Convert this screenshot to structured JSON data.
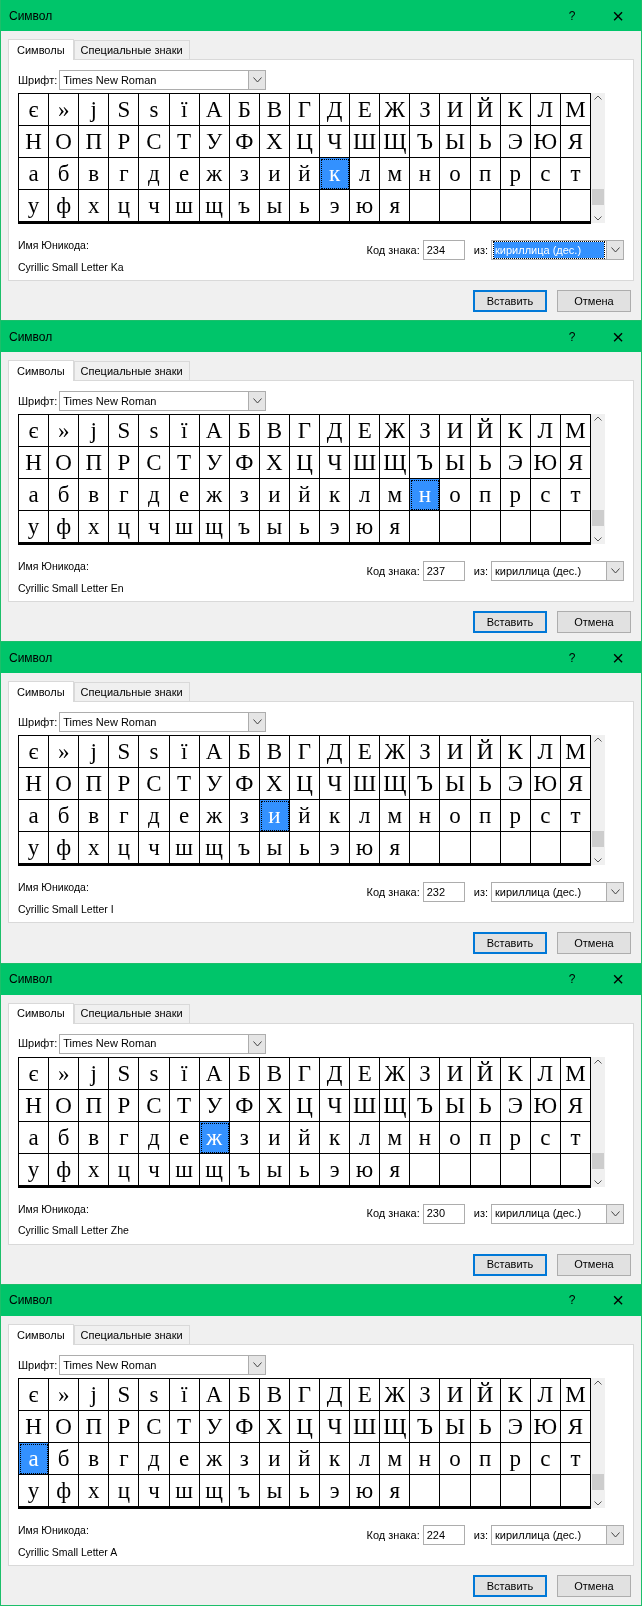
{
  "dialogs": [
    {
      "title": "Символ",
      "help": "?",
      "close": "×",
      "tabs": [
        {
          "label": "Символы",
          "selected": true
        },
        {
          "label": "Специальные знаки",
          "selected": false
        }
      ],
      "font_label": "Шрифт:",
      "font": "Times New Roman",
      "grid": [
        [
          {
            "char": "є",
            "selected": false
          },
          {
            "char": "»",
            "selected": false
          },
          {
            "char": "ј",
            "selected": false
          },
          {
            "char": "Ѕ",
            "selected": false
          },
          {
            "char": "ѕ",
            "selected": false
          },
          {
            "char": "ї",
            "selected": false
          },
          {
            "char": "А",
            "selected": false
          },
          {
            "char": "Б",
            "selected": false
          },
          {
            "char": "В",
            "selected": false
          },
          {
            "char": "Г",
            "selected": false
          },
          {
            "char": "Д",
            "selected": false
          },
          {
            "char": "Е",
            "selected": false
          },
          {
            "char": "Ж",
            "selected": false
          },
          {
            "char": "З",
            "selected": false
          },
          {
            "char": "И",
            "selected": false
          },
          {
            "char": "Й",
            "selected": false
          },
          {
            "char": "К",
            "selected": false
          },
          {
            "char": "Л",
            "selected": false
          },
          {
            "char": "М",
            "selected": false
          }
        ],
        [
          {
            "char": "Н",
            "selected": false
          },
          {
            "char": "О",
            "selected": false
          },
          {
            "char": "П",
            "selected": false
          },
          {
            "char": "Р",
            "selected": false
          },
          {
            "char": "С",
            "selected": false
          },
          {
            "char": "Т",
            "selected": false
          },
          {
            "char": "У",
            "selected": false
          },
          {
            "char": "Ф",
            "selected": false
          },
          {
            "char": "Х",
            "selected": false
          },
          {
            "char": "Ц",
            "selected": false
          },
          {
            "char": "Ч",
            "selected": false
          },
          {
            "char": "Ш",
            "selected": false
          },
          {
            "char": "Щ",
            "selected": false
          },
          {
            "char": "Ъ",
            "selected": false
          },
          {
            "char": "Ы",
            "selected": false
          },
          {
            "char": "Ь",
            "selected": false
          },
          {
            "char": "Э",
            "selected": false
          },
          {
            "char": "Ю",
            "selected": false
          },
          {
            "char": "Я",
            "selected": false
          }
        ],
        [
          {
            "char": "а",
            "selected": false
          },
          {
            "char": "б",
            "selected": false
          },
          {
            "char": "в",
            "selected": false
          },
          {
            "char": "г",
            "selected": false
          },
          {
            "char": "д",
            "selected": false
          },
          {
            "char": "е",
            "selected": false
          },
          {
            "char": "ж",
            "selected": false
          },
          {
            "char": "з",
            "selected": false
          },
          {
            "char": "и",
            "selected": false
          },
          {
            "char": "й",
            "selected": false
          },
          {
            "char": "к",
            "selected": true
          },
          {
            "char": "л",
            "selected": false
          },
          {
            "char": "м",
            "selected": false
          },
          {
            "char": "н",
            "selected": false
          },
          {
            "char": "о",
            "selected": false
          },
          {
            "char": "п",
            "selected": false
          },
          {
            "char": "р",
            "selected": false
          },
          {
            "char": "с",
            "selected": false
          },
          {
            "char": "т",
            "selected": false
          }
        ],
        [
          {
            "char": "у",
            "selected": false
          },
          {
            "char": "ф",
            "selected": false
          },
          {
            "char": "х",
            "selected": false
          },
          {
            "char": "ц",
            "selected": false
          },
          {
            "char": "ч",
            "selected": false
          },
          {
            "char": "ш",
            "selected": false
          },
          {
            "char": "щ",
            "selected": false
          },
          {
            "char": "ъ",
            "selected": false
          },
          {
            "char": "ы",
            "selected": false
          },
          {
            "char": "ь",
            "selected": false
          },
          {
            "char": "э",
            "selected": false
          },
          {
            "char": "ю",
            "selected": false
          },
          {
            "char": "я",
            "selected": false
          }
        ]
      ],
      "unicode_label": "Имя Юникода:",
      "unicode_name": "Cyrillic Small Letter Ka",
      "code_label": "Код знака:",
      "code": "234",
      "from_label": "из:",
      "from": "кириллица (дес.)",
      "from_focused": true,
      "insert": "Вставить",
      "cancel": "Отмена"
    },
    {
      "title": "Символ",
      "help": "?",
      "close": "×",
      "tabs": [
        {
          "label": "Символы",
          "selected": true
        },
        {
          "label": "Специальные знаки",
          "selected": false
        }
      ],
      "font_label": "Шрифт:",
      "font": "Times New Roman",
      "grid": [
        [
          {
            "char": "є",
            "selected": false
          },
          {
            "char": "»",
            "selected": false
          },
          {
            "char": "ј",
            "selected": false
          },
          {
            "char": "Ѕ",
            "selected": false
          },
          {
            "char": "ѕ",
            "selected": false
          },
          {
            "char": "ї",
            "selected": false
          },
          {
            "char": "А",
            "selected": false
          },
          {
            "char": "Б",
            "selected": false
          },
          {
            "char": "В",
            "selected": false
          },
          {
            "char": "Г",
            "selected": false
          },
          {
            "char": "Д",
            "selected": false
          },
          {
            "char": "Е",
            "selected": false
          },
          {
            "char": "Ж",
            "selected": false
          },
          {
            "char": "З",
            "selected": false
          },
          {
            "char": "И",
            "selected": false
          },
          {
            "char": "Й",
            "selected": false
          },
          {
            "char": "К",
            "selected": false
          },
          {
            "char": "Л",
            "selected": false
          },
          {
            "char": "М",
            "selected": false
          }
        ],
        [
          {
            "char": "Н",
            "selected": false
          },
          {
            "char": "О",
            "selected": false
          },
          {
            "char": "П",
            "selected": false
          },
          {
            "char": "Р",
            "selected": false
          },
          {
            "char": "С",
            "selected": false
          },
          {
            "char": "Т",
            "selected": false
          },
          {
            "char": "У",
            "selected": false
          },
          {
            "char": "Ф",
            "selected": false
          },
          {
            "char": "Х",
            "selected": false
          },
          {
            "char": "Ц",
            "selected": false
          },
          {
            "char": "Ч",
            "selected": false
          },
          {
            "char": "Ш",
            "selected": false
          },
          {
            "char": "Щ",
            "selected": false
          },
          {
            "char": "Ъ",
            "selected": false
          },
          {
            "char": "Ы",
            "selected": false
          },
          {
            "char": "Ь",
            "selected": false
          },
          {
            "char": "Э",
            "selected": false
          },
          {
            "char": "Ю",
            "selected": false
          },
          {
            "char": "Я",
            "selected": false
          }
        ],
        [
          {
            "char": "а",
            "selected": false
          },
          {
            "char": "б",
            "selected": false
          },
          {
            "char": "в",
            "selected": false
          },
          {
            "char": "г",
            "selected": false
          },
          {
            "char": "д",
            "selected": false
          },
          {
            "char": "е",
            "selected": false
          },
          {
            "char": "ж",
            "selected": false
          },
          {
            "char": "з",
            "selected": false
          },
          {
            "char": "и",
            "selected": false
          },
          {
            "char": "й",
            "selected": false
          },
          {
            "char": "к",
            "selected": false
          },
          {
            "char": "л",
            "selected": false
          },
          {
            "char": "м",
            "selected": false
          },
          {
            "char": "н",
            "selected": true
          },
          {
            "char": "о",
            "selected": false
          },
          {
            "char": "п",
            "selected": false
          },
          {
            "char": "р",
            "selected": false
          },
          {
            "char": "с",
            "selected": false
          },
          {
            "char": "т",
            "selected": false
          }
        ],
        [
          {
            "char": "у",
            "selected": false
          },
          {
            "char": "ф",
            "selected": false
          },
          {
            "char": "х",
            "selected": false
          },
          {
            "char": "ц",
            "selected": false
          },
          {
            "char": "ч",
            "selected": false
          },
          {
            "char": "ш",
            "selected": false
          },
          {
            "char": "щ",
            "selected": false
          },
          {
            "char": "ъ",
            "selected": false
          },
          {
            "char": "ы",
            "selected": false
          },
          {
            "char": "ь",
            "selected": false
          },
          {
            "char": "э",
            "selected": false
          },
          {
            "char": "ю",
            "selected": false
          },
          {
            "char": "я",
            "selected": false
          }
        ]
      ],
      "unicode_label": "Имя Юникода:",
      "unicode_name": "Cyrillic Small Letter En",
      "code_label": "Код знака:",
      "code": "237",
      "from_label": "из:",
      "from": "кириллица (дес.)",
      "from_focused": false,
      "insert": "Вставить",
      "cancel": "Отмена"
    },
    {
      "title": "Символ",
      "help": "?",
      "close": "×",
      "tabs": [
        {
          "label": "Символы",
          "selected": true
        },
        {
          "label": "Специальные знаки",
          "selected": false
        }
      ],
      "font_label": "Шрифт:",
      "font": "Times New Roman",
      "grid": [
        [
          {
            "char": "є",
            "selected": false
          },
          {
            "char": "»",
            "selected": false
          },
          {
            "char": "ј",
            "selected": false
          },
          {
            "char": "Ѕ",
            "selected": false
          },
          {
            "char": "ѕ",
            "selected": false
          },
          {
            "char": "ї",
            "selected": false
          },
          {
            "char": "А",
            "selected": false
          },
          {
            "char": "Б",
            "selected": false
          },
          {
            "char": "В",
            "selected": false
          },
          {
            "char": "Г",
            "selected": false
          },
          {
            "char": "Д",
            "selected": false
          },
          {
            "char": "Е",
            "selected": false
          },
          {
            "char": "Ж",
            "selected": false
          },
          {
            "char": "З",
            "selected": false
          },
          {
            "char": "И",
            "selected": false
          },
          {
            "char": "Й",
            "selected": false
          },
          {
            "char": "К",
            "selected": false
          },
          {
            "char": "Л",
            "selected": false
          },
          {
            "char": "М",
            "selected": false
          }
        ],
        [
          {
            "char": "Н",
            "selected": false
          },
          {
            "char": "О",
            "selected": false
          },
          {
            "char": "П",
            "selected": false
          },
          {
            "char": "Р",
            "selected": false
          },
          {
            "char": "С",
            "selected": false
          },
          {
            "char": "Т",
            "selected": false
          },
          {
            "char": "У",
            "selected": false
          },
          {
            "char": "Ф",
            "selected": false
          },
          {
            "char": "Х",
            "selected": false
          },
          {
            "char": "Ц",
            "selected": false
          },
          {
            "char": "Ч",
            "selected": false
          },
          {
            "char": "Ш",
            "selected": false
          },
          {
            "char": "Щ",
            "selected": false
          },
          {
            "char": "Ъ",
            "selected": false
          },
          {
            "char": "Ы",
            "selected": false
          },
          {
            "char": "Ь",
            "selected": false
          },
          {
            "char": "Э",
            "selected": false
          },
          {
            "char": "Ю",
            "selected": false
          },
          {
            "char": "Я",
            "selected": false
          }
        ],
        [
          {
            "char": "а",
            "selected": false
          },
          {
            "char": "б",
            "selected": false
          },
          {
            "char": "в",
            "selected": false
          },
          {
            "char": "г",
            "selected": false
          },
          {
            "char": "д",
            "selected": false
          },
          {
            "char": "е",
            "selected": false
          },
          {
            "char": "ж",
            "selected": false
          },
          {
            "char": "з",
            "selected": false
          },
          {
            "char": "и",
            "selected": true
          },
          {
            "char": "й",
            "selected": false
          },
          {
            "char": "к",
            "selected": false
          },
          {
            "char": "л",
            "selected": false
          },
          {
            "char": "м",
            "selected": false
          },
          {
            "char": "н",
            "selected": false
          },
          {
            "char": "о",
            "selected": false
          },
          {
            "char": "п",
            "selected": false
          },
          {
            "char": "р",
            "selected": false
          },
          {
            "char": "с",
            "selected": false
          },
          {
            "char": "т",
            "selected": false
          }
        ],
        [
          {
            "char": "у",
            "selected": false
          },
          {
            "char": "ф",
            "selected": false
          },
          {
            "char": "х",
            "selected": false
          },
          {
            "char": "ц",
            "selected": false
          },
          {
            "char": "ч",
            "selected": false
          },
          {
            "char": "ш",
            "selected": false
          },
          {
            "char": "щ",
            "selected": false
          },
          {
            "char": "ъ",
            "selected": false
          },
          {
            "char": "ы",
            "selected": false
          },
          {
            "char": "ь",
            "selected": false
          },
          {
            "char": "э",
            "selected": false
          },
          {
            "char": "ю",
            "selected": false
          },
          {
            "char": "я",
            "selected": false
          }
        ]
      ],
      "unicode_label": "Имя Юникода:",
      "unicode_name": "Cyrillic Small Letter I",
      "code_label": "Код знака:",
      "code": "232",
      "from_label": "из:",
      "from": "кириллица (дес.)",
      "from_focused": false,
      "insert": "Вставить",
      "cancel": "Отмена"
    },
    {
      "title": "Символ",
      "help": "?",
      "close": "×",
      "tabs": [
        {
          "label": "Символы",
          "selected": true
        },
        {
          "label": "Специальные знаки",
          "selected": false
        }
      ],
      "font_label": "Шрифт:",
      "font": "Times New Roman",
      "grid": [
        [
          {
            "char": "є",
            "selected": false
          },
          {
            "char": "»",
            "selected": false
          },
          {
            "char": "ј",
            "selected": false
          },
          {
            "char": "Ѕ",
            "selected": false
          },
          {
            "char": "ѕ",
            "selected": false
          },
          {
            "char": "ї",
            "selected": false
          },
          {
            "char": "А",
            "selected": false
          },
          {
            "char": "Б",
            "selected": false
          },
          {
            "char": "В",
            "selected": false
          },
          {
            "char": "Г",
            "selected": false
          },
          {
            "char": "Д",
            "selected": false
          },
          {
            "char": "Е",
            "selected": false
          },
          {
            "char": "Ж",
            "selected": false
          },
          {
            "char": "З",
            "selected": false
          },
          {
            "char": "И",
            "selected": false
          },
          {
            "char": "Й",
            "selected": false
          },
          {
            "char": "К",
            "selected": false
          },
          {
            "char": "Л",
            "selected": false
          },
          {
            "char": "М",
            "selected": false
          }
        ],
        [
          {
            "char": "Н",
            "selected": false
          },
          {
            "char": "О",
            "selected": false
          },
          {
            "char": "П",
            "selected": false
          },
          {
            "char": "Р",
            "selected": false
          },
          {
            "char": "С",
            "selected": false
          },
          {
            "char": "Т",
            "selected": false
          },
          {
            "char": "У",
            "selected": false
          },
          {
            "char": "Ф",
            "selected": false
          },
          {
            "char": "Х",
            "selected": false
          },
          {
            "char": "Ц",
            "selected": false
          },
          {
            "char": "Ч",
            "selected": false
          },
          {
            "char": "Ш",
            "selected": false
          },
          {
            "char": "Щ",
            "selected": false
          },
          {
            "char": "Ъ",
            "selected": false
          },
          {
            "char": "Ы",
            "selected": false
          },
          {
            "char": "Ь",
            "selected": false
          },
          {
            "char": "Э",
            "selected": false
          },
          {
            "char": "Ю",
            "selected": false
          },
          {
            "char": "Я",
            "selected": false
          }
        ],
        [
          {
            "char": "а",
            "selected": false
          },
          {
            "char": "б",
            "selected": false
          },
          {
            "char": "в",
            "selected": false
          },
          {
            "char": "г",
            "selected": false
          },
          {
            "char": "д",
            "selected": false
          },
          {
            "char": "е",
            "selected": false
          },
          {
            "char": "ж",
            "selected": true
          },
          {
            "char": "з",
            "selected": false
          },
          {
            "char": "и",
            "selected": false
          },
          {
            "char": "й",
            "selected": false
          },
          {
            "char": "к",
            "selected": false
          },
          {
            "char": "л",
            "selected": false
          },
          {
            "char": "м",
            "selected": false
          },
          {
            "char": "н",
            "selected": false
          },
          {
            "char": "о",
            "selected": false
          },
          {
            "char": "п",
            "selected": false
          },
          {
            "char": "р",
            "selected": false
          },
          {
            "char": "с",
            "selected": false
          },
          {
            "char": "т",
            "selected": false
          }
        ],
        [
          {
            "char": "у",
            "selected": false
          },
          {
            "char": "ф",
            "selected": false
          },
          {
            "char": "х",
            "selected": false
          },
          {
            "char": "ц",
            "selected": false
          },
          {
            "char": "ч",
            "selected": false
          },
          {
            "char": "ш",
            "selected": false
          },
          {
            "char": "щ",
            "selected": false
          },
          {
            "char": "ъ",
            "selected": false
          },
          {
            "char": "ы",
            "selected": false
          },
          {
            "char": "ь",
            "selected": false
          },
          {
            "char": "э",
            "selected": false
          },
          {
            "char": "ю",
            "selected": false
          },
          {
            "char": "я",
            "selected": false
          }
        ]
      ],
      "unicode_label": "Имя Юникода:",
      "unicode_name": "Cyrillic Small Letter Zhe",
      "code_label": "Код знака:",
      "code": "230",
      "from_label": "из:",
      "from": "кириллица (дес.)",
      "from_focused": false,
      "insert": "Вставить",
      "cancel": "Отмена"
    },
    {
      "title": "Символ",
      "help": "?",
      "close": "×",
      "tabs": [
        {
          "label": "Символы",
          "selected": true
        },
        {
          "label": "Специальные знаки",
          "selected": false
        }
      ],
      "font_label": "Шрифт:",
      "font": "Times New Roman",
      "grid": [
        [
          {
            "char": "є",
            "selected": false
          },
          {
            "char": "»",
            "selected": false
          },
          {
            "char": "ј",
            "selected": false
          },
          {
            "char": "Ѕ",
            "selected": false
          },
          {
            "char": "ѕ",
            "selected": false
          },
          {
            "char": "ї",
            "selected": false
          },
          {
            "char": "А",
            "selected": false
          },
          {
            "char": "Б",
            "selected": false
          },
          {
            "char": "В",
            "selected": false
          },
          {
            "char": "Г",
            "selected": false
          },
          {
            "char": "Д",
            "selected": false
          },
          {
            "char": "Е",
            "selected": false
          },
          {
            "char": "Ж",
            "selected": false
          },
          {
            "char": "З",
            "selected": false
          },
          {
            "char": "И",
            "selected": false
          },
          {
            "char": "Й",
            "selected": false
          },
          {
            "char": "К",
            "selected": false
          },
          {
            "char": "Л",
            "selected": false
          },
          {
            "char": "М",
            "selected": false
          }
        ],
        [
          {
            "char": "Н",
            "selected": false
          },
          {
            "char": "О",
            "selected": false
          },
          {
            "char": "П",
            "selected": false
          },
          {
            "char": "Р",
            "selected": false
          },
          {
            "char": "С",
            "selected": false
          },
          {
            "char": "Т",
            "selected": false
          },
          {
            "char": "У",
            "selected": false
          },
          {
            "char": "Ф",
            "selected": false
          },
          {
            "char": "Х",
            "selected": false
          },
          {
            "char": "Ц",
            "selected": false
          },
          {
            "char": "Ч",
            "selected": false
          },
          {
            "char": "Ш",
            "selected": false
          },
          {
            "char": "Щ",
            "selected": false
          },
          {
            "char": "Ъ",
            "selected": false
          },
          {
            "char": "Ы",
            "selected": false
          },
          {
            "char": "Ь",
            "selected": false
          },
          {
            "char": "Э",
            "selected": false
          },
          {
            "char": "Ю",
            "selected": false
          },
          {
            "char": "Я",
            "selected": false
          }
        ],
        [
          {
            "char": "а",
            "selected": true
          },
          {
            "char": "б",
            "selected": false
          },
          {
            "char": "в",
            "selected": false
          },
          {
            "char": "г",
            "selected": false
          },
          {
            "char": "д",
            "selected": false
          },
          {
            "char": "е",
            "selected": false
          },
          {
            "char": "ж",
            "selected": false
          },
          {
            "char": "з",
            "selected": false
          },
          {
            "char": "и",
            "selected": false
          },
          {
            "char": "й",
            "selected": false
          },
          {
            "char": "к",
            "selected": false
          },
          {
            "char": "л",
            "selected": false
          },
          {
            "char": "м",
            "selected": false
          },
          {
            "char": "н",
            "selected": false
          },
          {
            "char": "о",
            "selected": false
          },
          {
            "char": "п",
            "selected": false
          },
          {
            "char": "р",
            "selected": false
          },
          {
            "char": "с",
            "selected": false
          },
          {
            "char": "т",
            "selected": false
          }
        ],
        [
          {
            "char": "у",
            "selected": false
          },
          {
            "char": "ф",
            "selected": false
          },
          {
            "char": "х",
            "selected": false
          },
          {
            "char": "ц",
            "selected": false
          },
          {
            "char": "ч",
            "selected": false
          },
          {
            "char": "ш",
            "selected": false
          },
          {
            "char": "щ",
            "selected": false
          },
          {
            "char": "ъ",
            "selected": false
          },
          {
            "char": "ы",
            "selected": false
          },
          {
            "char": "ь",
            "selected": false
          },
          {
            "char": "э",
            "selected": false
          },
          {
            "char": "ю",
            "selected": false
          },
          {
            "char": "я",
            "selected": false
          }
        ]
      ],
      "unicode_label": "Имя Юникода:",
      "unicode_name": "Cyrillic Small Letter A",
      "code_label": "Код знака:",
      "code": "224",
      "from_label": "из:",
      "from": "кириллица (дес.)",
      "from_focused": false,
      "insert": "Вставить",
      "cancel": "Отмена"
    }
  ]
}
